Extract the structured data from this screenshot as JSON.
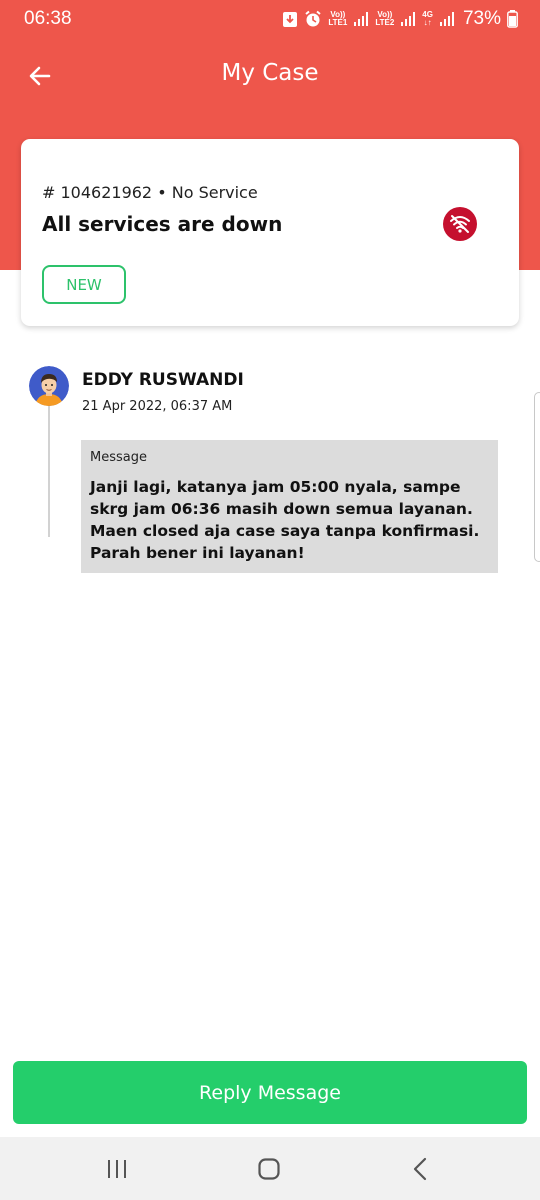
{
  "status_bar": {
    "time": "06:38",
    "network1_top": "Vo))",
    "network1_bottom": "LTE1",
    "network2_top": "Vo))",
    "network2_bottom": "LTE2",
    "network_type": "4G",
    "battery": "73%"
  },
  "app_bar": {
    "title": "My Case"
  },
  "case": {
    "meta": "# 104621962 • No Service",
    "title": "All services are down",
    "badge": "NEW",
    "status_icon": "wifi-off-icon"
  },
  "message": {
    "sender": "EDDY RUSWANDI",
    "date": "21 Apr 2022, 06:37 AM",
    "label": "Message",
    "text": "Janji lagi, katanya jam 05:00 nyala, sampe skrg jam 06:36 masih down semua layanan. Maen closed aja case saya tanpa konfirmasi. Parah bener ini layanan!"
  },
  "footer": {
    "reply_label": "Reply Message"
  },
  "colors": {
    "header": "#EE564B",
    "accent_green": "#24CE6B",
    "badge_green": "#2DC26B",
    "status_red": "#C5102E"
  }
}
